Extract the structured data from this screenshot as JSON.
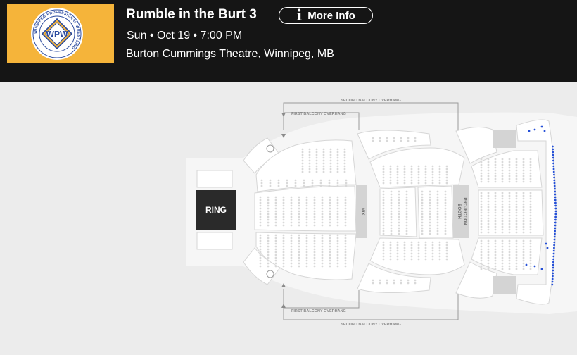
{
  "event": {
    "title": "Rumble in the Burt 3",
    "datetime": "Sun • Oct 19 • 7:00 PM",
    "venue": "Burton Cummings Theatre, Winnipeg, MB",
    "more_info_label": "More Info",
    "more_info_icon": "info-icon",
    "logo": {
      "initials": "WPW",
      "ring_text": "WINNIPEG PROFESSIONAL WRESTLING",
      "bg_color": "#f5b43a",
      "ring_color": "#2a4a9e",
      "inner_color": "#f5b43a"
    }
  },
  "seatmap": {
    "stage_label": "RING",
    "mix_label": "MIX",
    "projection_label_1": "PROJECTION",
    "projection_label_2": "BOOTH",
    "first_balcony_top": "FIRST BALCONY OVERHANG",
    "second_balcony_top": "SECOND BALCONY OVERHANG",
    "first_balcony_bottom": "FIRST BALCONY OVERHANG",
    "second_balcony_bottom": "SECOND BALCONY OVERHANG",
    "available_seat_color": "#2550d8",
    "unavailable_seat_color": "#d9d9d9",
    "section_color": "#ffffff",
    "background_color": "#ececec"
  }
}
